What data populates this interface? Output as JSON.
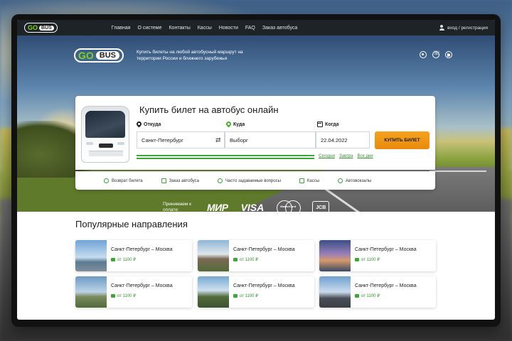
{
  "brand": {
    "go": "GO",
    "bus": "BUS"
  },
  "nav": {
    "items": [
      "Главная",
      "О системе",
      "Контакты",
      "Кассы",
      "Новости",
      "FAQ",
      "Заказ автобуса"
    ],
    "login": "вход / регистрация"
  },
  "hero": {
    "tagline": "Купить билеты на любой автобусный маршрут на территории России и ближнего зарубежья",
    "icons": [
      "viber-icon",
      "phone-icon",
      "telegram-icon"
    ]
  },
  "search": {
    "title": "Купить билет на автобус онлайн",
    "from_label": "Откуда",
    "to_label": "Куда",
    "date_label": "Когда",
    "from_value": "Санкт-Петербург",
    "to_value": "Выборг",
    "date_value": "22.04.2022",
    "buy_label": "КУПИТЬ БИЛЕТ",
    "quick_dates": [
      "Сегодня",
      "Завтра",
      "Все дни"
    ]
  },
  "features": [
    "Возврат билета",
    "Заказ автобуса",
    "Часто задаваемые вопросы",
    "Кассы",
    "Автовокзалы"
  ],
  "payment": {
    "label": "Принимаем к оплате:",
    "methods": [
      "МИР",
      "VISA",
      "MasterCard",
      "JCB"
    ]
  },
  "popular": {
    "title": "Популярные направления",
    "cards": [
      {
        "route": "Санкт-Петербург – Москва",
        "price": "от 1100 ₽"
      },
      {
        "route": "Санкт-Петербург – Москва",
        "price": "от 1100 ₽"
      },
      {
        "route": "Санкт-Петербург – Москва",
        "price": "от 1100 ₽"
      },
      {
        "route": "Санкт-Петербург – Москва",
        "price": "от 1100 ₽"
      },
      {
        "route": "Санкт-Петербург – Москва",
        "price": "от 1100 ₽"
      },
      {
        "route": "Санкт-Петербург – Москва",
        "price": "от 1100 ₽"
      }
    ]
  },
  "colors": {
    "accent_green": "#3aa935",
    "buy_orange": "#f6a31e",
    "topbar": "#1e2328"
  }
}
